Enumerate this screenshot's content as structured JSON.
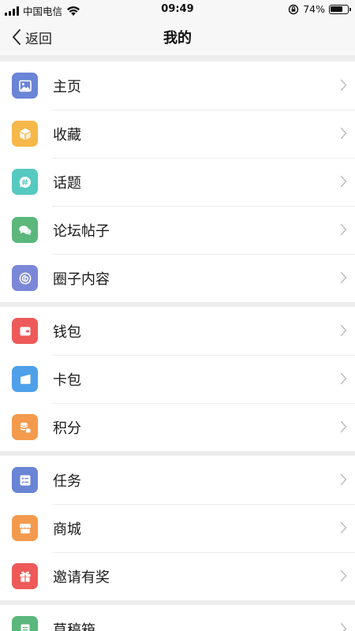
{
  "status_bar": {
    "carrier": "中国电信",
    "time": "09:49",
    "battery_percent": "74%",
    "battery_level": 0.74
  },
  "nav": {
    "back_label": "返回",
    "title": "我的"
  },
  "groups": [
    {
      "items": [
        {
          "label": "主页",
          "icon": "image-icon",
          "color": "#6a84d6"
        },
        {
          "label": "收藏",
          "icon": "box-icon",
          "color": "#f5b849"
        },
        {
          "label": "话题",
          "icon": "topic-hash-icon",
          "color": "#56c9c0"
        },
        {
          "label": "论坛帖子",
          "icon": "chat-bubbles-icon",
          "color": "#5bb77c"
        },
        {
          "label": "圈子内容",
          "icon": "circle-swirl-icon",
          "color": "#7b87d8"
        }
      ]
    },
    {
      "items": [
        {
          "label": "钱包",
          "icon": "wallet-icon",
          "color": "#ee5a5a"
        },
        {
          "label": "卡包",
          "icon": "card-icon",
          "color": "#4fa0ea"
        },
        {
          "label": "积分",
          "icon": "coins-icon",
          "color": "#f39a4d"
        }
      ]
    },
    {
      "items": [
        {
          "label": "任务",
          "icon": "task-list-icon",
          "color": "#6a84d6"
        },
        {
          "label": "商城",
          "icon": "store-icon",
          "color": "#f39a4d"
        },
        {
          "label": "邀请有奖",
          "icon": "gift-icon",
          "color": "#ee5a5a"
        }
      ]
    },
    {
      "items": [
        {
          "label": "草稿箱",
          "icon": "draft-icon",
          "color": "#5bb77c"
        }
      ]
    }
  ]
}
